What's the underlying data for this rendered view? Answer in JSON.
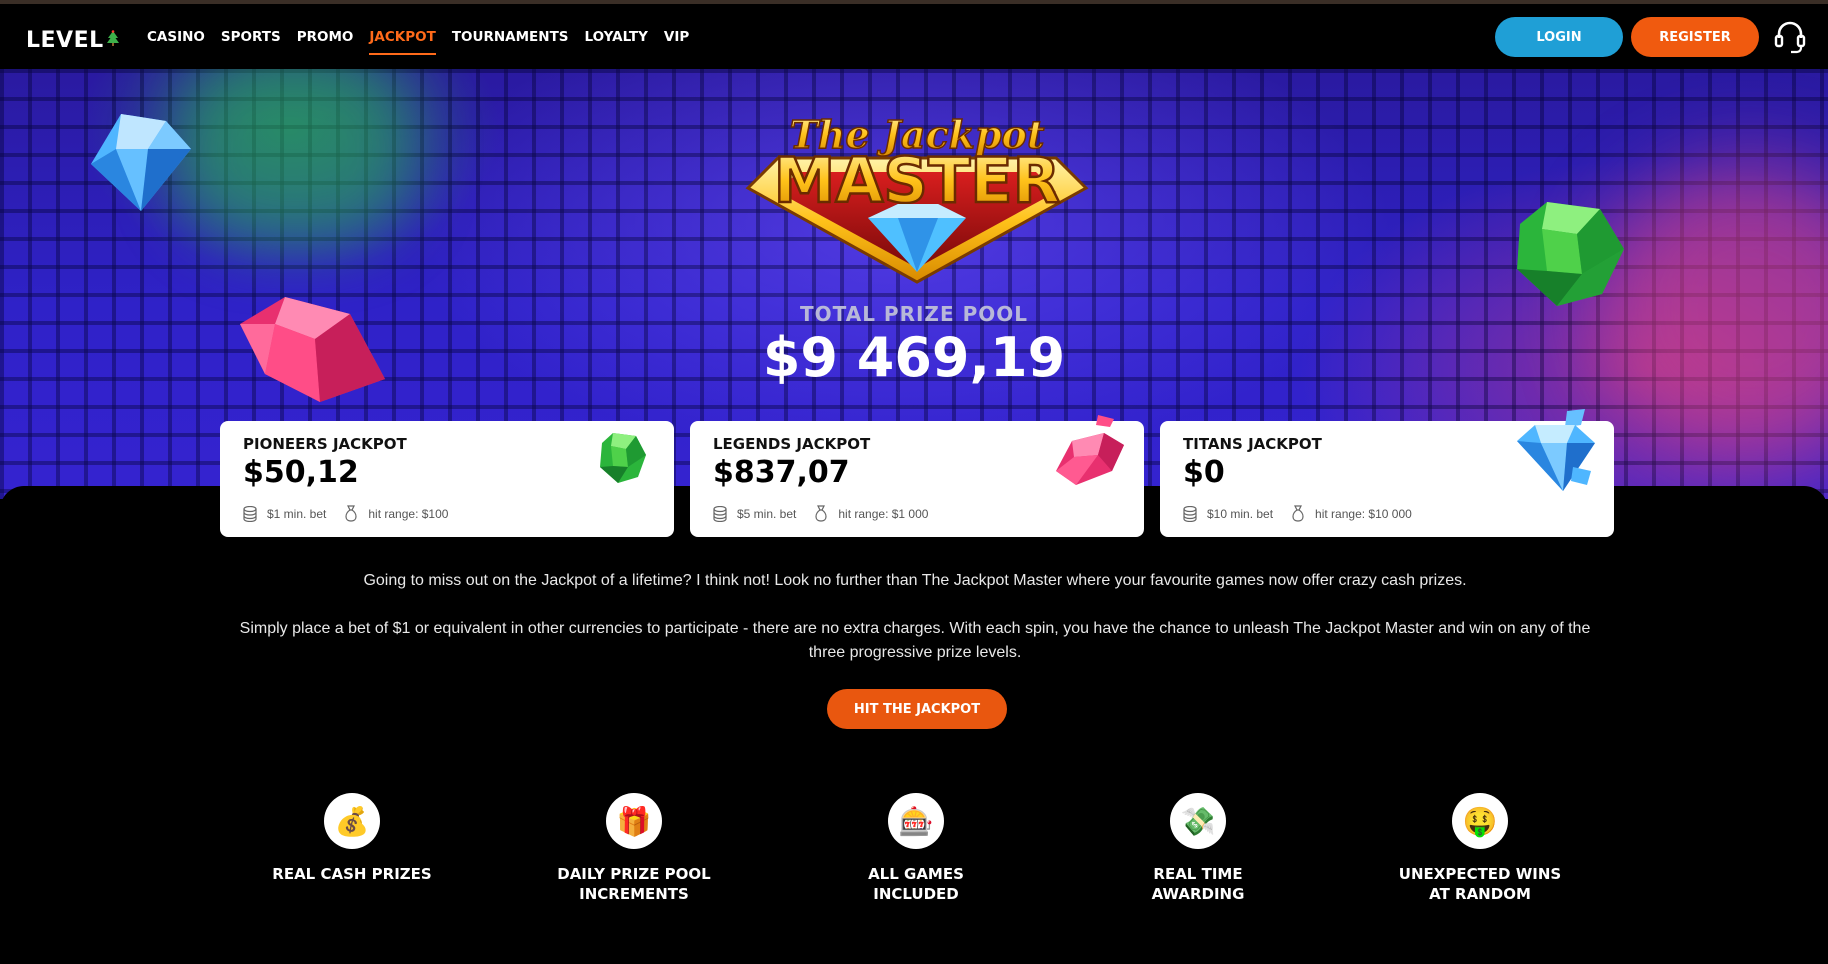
{
  "header": {
    "logo_text": "LEVEL",
    "nav": [
      {
        "label": "CASINO",
        "active": false
      },
      {
        "label": "SPORTS",
        "active": false
      },
      {
        "label": "PROMO",
        "active": false
      },
      {
        "label": "JACKPOT",
        "active": true
      },
      {
        "label": "TOURNAMENTS",
        "active": false
      },
      {
        "label": "LOYALTY",
        "active": false
      },
      {
        "label": "VIP",
        "active": false
      }
    ],
    "login_label": "LOGIN",
    "register_label": "REGISTER",
    "support_icon": "headset-icon"
  },
  "hero": {
    "logo_top": "The Jackpot",
    "logo_main": "MASTER",
    "pool_label": "TOTAL PRIZE POOL",
    "pool_value": "$9 469,19"
  },
  "jackpots": [
    {
      "title": "PIONEERS JACKPOT",
      "value": "$50,12",
      "min_bet": "$1 min. bet",
      "hit_range": "hit range: $100",
      "gem": "green"
    },
    {
      "title": "LEGENDS JACKPOT",
      "value": "$837,07",
      "min_bet": "$5 min. bet",
      "hit_range": "hit range: $1 000",
      "gem": "pink"
    },
    {
      "title": "TITANS JACKPOT",
      "value": "$0",
      "min_bet": "$10 min. bet",
      "hit_range": "hit range: $10 000",
      "gem": "blue"
    }
  ],
  "description": {
    "p1": "Going to miss out on the Jackpot of a lifetime? I think not! Look no further than The Jackpot Master where your favourite games now offer crazy cash prizes.",
    "p2": "Simply place a bet of $1 or equivalent in other currencies to participate - there are no extra charges. With each spin, you have the chance to unleash The Jackpot Master and win on any of the three progressive prize levels."
  },
  "cta_label": "HIT THE JACKPOT",
  "features": [
    {
      "icon": "money-bag-icon",
      "glyph": "💰",
      "line1": "REAL CASH PRIZES",
      "line2": ""
    },
    {
      "icon": "gift-icon",
      "glyph": "🎁",
      "line1": "DAILY PRIZE POOL",
      "line2": "INCREMENTS"
    },
    {
      "icon": "slot-machine-icon",
      "glyph": "🎰",
      "line1": "ALL GAMES",
      "line2": "INCLUDED"
    },
    {
      "icon": "money-wings-icon",
      "glyph": "💸",
      "line1": "REAL TIME",
      "line2": "AWARDING"
    },
    {
      "icon": "money-face-icon",
      "glyph": "🤑",
      "line1": "UNEXPECTED WINS",
      "line2": "AT RANDOM"
    }
  ],
  "colors": {
    "accent_orange": "#f05a0f",
    "login_blue": "#1f9fd6",
    "hero_blue": "#2f22c8"
  }
}
